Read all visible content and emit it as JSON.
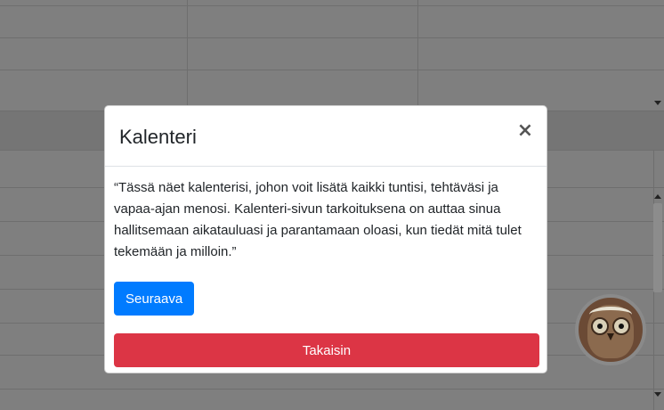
{
  "modal": {
    "title": "Kalenteri",
    "close_symbol": "×",
    "text": "“Tässä näet kalenterisi, johon voit lisätä kaikki tuntisi, tehtäväsi ja vapaa-ajan menosi. Kalenteri-sivun tarkoituksena on auttaa sinua hallitsemaan aikatauluasi ja parantamaan oloasi, kun tiedät mitä tulet tekemään ja milloin.”",
    "next_label": "Seuraava",
    "back_label": "Takaisin"
  },
  "colors": {
    "primary": "#007bff",
    "danger": "#dc3545",
    "overlay": "#7f7f7f"
  },
  "avatar": {
    "icon": "owl-icon"
  }
}
